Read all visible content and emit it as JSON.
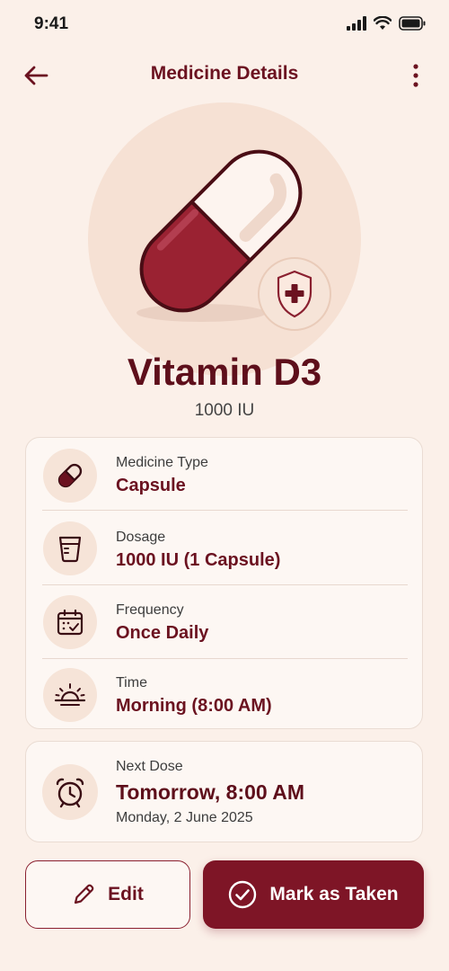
{
  "status_bar": {
    "time": "9:41"
  },
  "header": {
    "title": "Medicine Details"
  },
  "medicine": {
    "name": "Vitamin D3",
    "strength": "1000 IU"
  },
  "details": [
    {
      "label": "Medicine Type",
      "value": "Capsule",
      "icon": "capsule-icon"
    },
    {
      "label": "Dosage",
      "value": "1000 IU (1 Capsule)",
      "icon": "cup-icon"
    },
    {
      "label": "Frequency",
      "value": "Once Daily",
      "icon": "calendar-icon"
    },
    {
      "label": "Time",
      "value": "Morning (8:00 AM)",
      "icon": "sunrise-icon"
    }
  ],
  "next_dose": {
    "label": "Next Dose",
    "value": "Tomorrow, 8:00 AM",
    "date": "Monday, 2 June 2025",
    "icon": "alarm-clock-icon"
  },
  "actions": {
    "edit_label": "Edit",
    "taken_label": "Mark as Taken"
  },
  "colors": {
    "primary": "#7e1526",
    "text_primary": "#6b1220",
    "background": "#fbf0e9",
    "card": "#fdf7f3"
  }
}
